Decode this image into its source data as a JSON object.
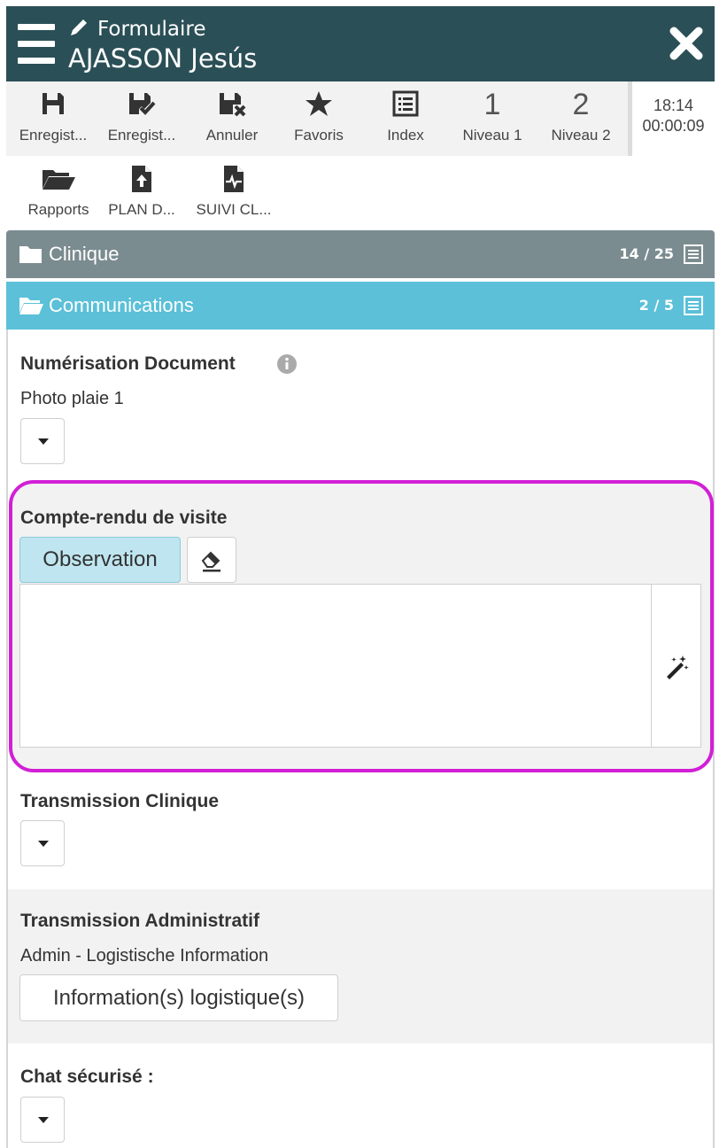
{
  "header": {
    "subtitle": "Formulaire",
    "title": "AJASSON Jesús"
  },
  "toolbar": {
    "items": [
      {
        "label": "Enregist...",
        "icon": "save-icon"
      },
      {
        "label": "Enregist...",
        "icon": "save-check-icon"
      },
      {
        "label": "Annuler",
        "icon": "save-cancel-icon"
      },
      {
        "label": "Favoris",
        "icon": "star-icon"
      },
      {
        "label": "Index",
        "icon": "list-icon"
      },
      {
        "label": "Niveau 1",
        "number": "1"
      },
      {
        "label": "Niveau 2",
        "number": "2"
      }
    ],
    "timer": {
      "time": "18:14",
      "elapsed": "00:00:09"
    },
    "row2": [
      {
        "label": "Rapports",
        "icon": "folder-open-icon"
      },
      {
        "label": "PLAN D...",
        "icon": "document-upload-icon"
      },
      {
        "label": "SUIVI CL...",
        "icon": "document-pulse-icon"
      }
    ]
  },
  "sections": {
    "clinique": {
      "title": "Clinique",
      "count": "14 / 25"
    },
    "communications": {
      "title": "Communications",
      "count": "2 / 5"
    }
  },
  "fields": {
    "numerisation": {
      "label": "Numérisation Document",
      "value": "Photo plaie 1"
    },
    "compte_rendu": {
      "label": "Compte-rendu de visite",
      "tab_label": "Observation",
      "text": ""
    },
    "transmission_clinique": {
      "label": "Transmission Clinique"
    },
    "transmission_admin": {
      "label": "Transmission Administratif",
      "value": "Admin - Logistische Information",
      "button_label": "Information(s) logistique(s)"
    },
    "chat": {
      "label": "Chat sécurisé :"
    }
  },
  "colors": {
    "header_bg": "#2b4f56",
    "section_clinique": "#7b8c90",
    "section_communications": "#5bc0d8",
    "highlight_border": "#d21fd6",
    "observation_bg": "#bfe6f0"
  }
}
